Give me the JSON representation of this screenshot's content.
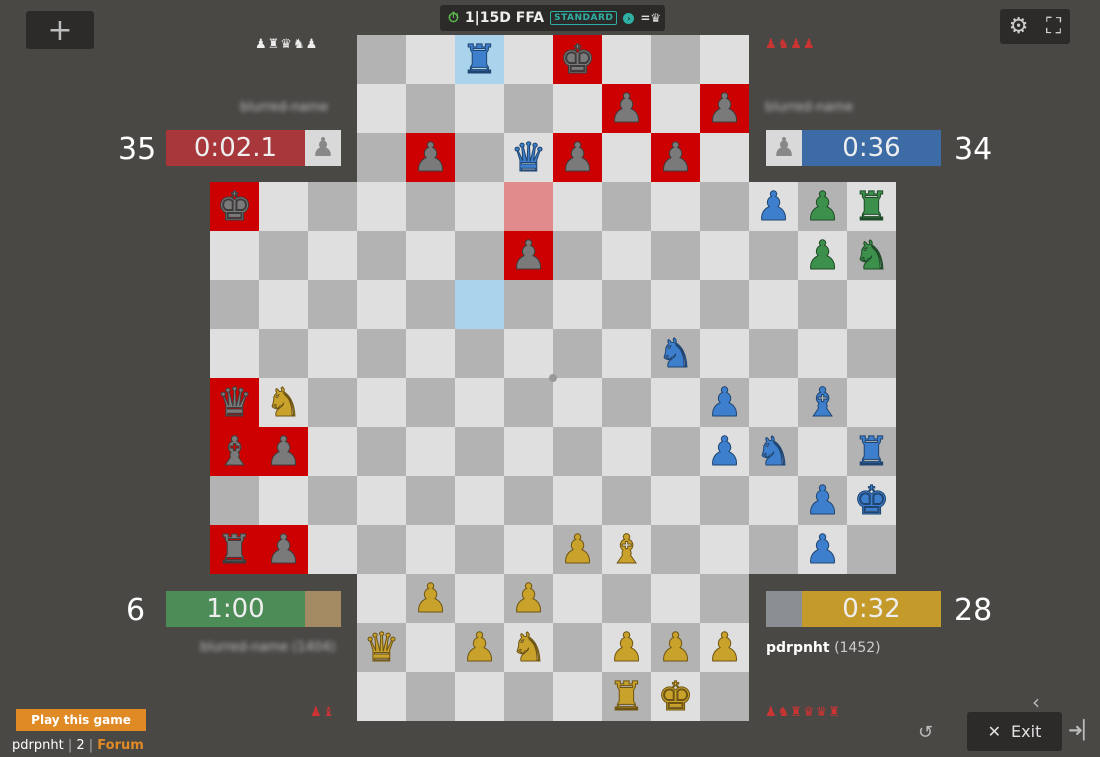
{
  "header": {
    "add_icon": "+",
    "timer_icon": "⏱",
    "time_control": "1|15D FFA",
    "mode_badge": "STANDARD",
    "info_icon": "›",
    "variant_icon": "=♛"
  },
  "toolbar": {
    "settings_icon": "⚙",
    "fullscreen_icon": "⛶"
  },
  "players": {
    "red": {
      "name": "blurred-name",
      "score": "35",
      "clock": "0:02.1",
      "clock_color": "#a8373c",
      "avatar": "♟",
      "captured": "♟♞♟♟"
    },
    "blue": {
      "name": "blurred-name",
      "score": "34",
      "clock": "0:36",
      "clock_color": "#3c6ba6",
      "avatar": "♟",
      "captured": "♟♜♛♞♟"
    },
    "yellow": {
      "name": "blurred-name (1404)",
      "score": "6",
      "clock": "1:00",
      "clock_color": "#4c8c56",
      "avatar": "",
      "captured": "♟♝"
    },
    "green": {
      "name": "pdrpnht",
      "rating": "(1452)",
      "score": "28",
      "clock": "0:32",
      "clock_color": "#c49a2a",
      "avatar": "",
      "captured": "♟♞♜♛♛♜"
    }
  },
  "board": {
    "pieces": [
      {
        "r": 0,
        "c": 5,
        "p": "♜",
        "k": "blue"
      },
      {
        "r": 0,
        "c": 7,
        "p": "♚",
        "k": "red"
      },
      {
        "r": 1,
        "c": 8,
        "p": "♟",
        "k": "red"
      },
      {
        "r": 1,
        "c": 10,
        "p": "♟",
        "k": "red"
      },
      {
        "r": 2,
        "c": 4,
        "p": "♟",
        "k": "red"
      },
      {
        "r": 2,
        "c": 6,
        "p": "♛",
        "k": "blue"
      },
      {
        "r": 2,
        "c": 7,
        "p": "♟",
        "k": "red"
      },
      {
        "r": 2,
        "c": 9,
        "p": "♟",
        "k": "red"
      },
      {
        "r": 3,
        "c": 0,
        "p": "♚",
        "k": "red"
      },
      {
        "r": 3,
        "c": 11,
        "p": "♟",
        "k": "blue"
      },
      {
        "r": 3,
        "c": 12,
        "p": "♟",
        "k": "green"
      },
      {
        "r": 3,
        "c": 13,
        "p": "♜",
        "k": "green"
      },
      {
        "r": 4,
        "c": 6,
        "p": "♟",
        "k": "red"
      },
      {
        "r": 4,
        "c": 12,
        "p": "♟",
        "k": "green"
      },
      {
        "r": 4,
        "c": 13,
        "p": "♞",
        "k": "green"
      },
      {
        "r": 6,
        "c": 9,
        "p": "♞",
        "k": "blue"
      },
      {
        "r": 7,
        "c": 0,
        "p": "♛",
        "k": "red"
      },
      {
        "r": 7,
        "c": 1,
        "p": "♞",
        "k": "yellow"
      },
      {
        "r": 7,
        "c": 10,
        "p": "♟",
        "k": "blue"
      },
      {
        "r": 7,
        "c": 12,
        "p": "♝",
        "k": "blue"
      },
      {
        "r": 8,
        "c": 0,
        "p": "♝",
        "k": "red"
      },
      {
        "r": 8,
        "c": 1,
        "p": "♟",
        "k": "red"
      },
      {
        "r": 8,
        "c": 10,
        "p": "♟",
        "k": "blue"
      },
      {
        "r": 8,
        "c": 11,
        "p": "♞",
        "k": "blue"
      },
      {
        "r": 8,
        "c": 13,
        "p": "♜",
        "k": "blue"
      },
      {
        "r": 9,
        "c": 12,
        "p": "♟",
        "k": "blue"
      },
      {
        "r": 9,
        "c": 13,
        "p": "♚",
        "k": "blue"
      },
      {
        "r": 10,
        "c": 0,
        "p": "♜",
        "k": "red"
      },
      {
        "r": 10,
        "c": 1,
        "p": "♟",
        "k": "red"
      },
      {
        "r": 10,
        "c": 7,
        "p": "♟",
        "k": "yellow"
      },
      {
        "r": 10,
        "c": 8,
        "p": "♝",
        "k": "yellow"
      },
      {
        "r": 10,
        "c": 12,
        "p": "♟",
        "k": "blue"
      },
      {
        "r": 11,
        "c": 4,
        "p": "♟",
        "k": "yellow"
      },
      {
        "r": 11,
        "c": 6,
        "p": "♟",
        "k": "yellow"
      },
      {
        "r": 12,
        "c": 3,
        "p": "♛",
        "k": "yellow"
      },
      {
        "r": 12,
        "c": 5,
        "p": "♟",
        "k": "yellow"
      },
      {
        "r": 12,
        "c": 6,
        "p": "♞",
        "k": "yellow"
      },
      {
        "r": 12,
        "c": 8,
        "p": "♟",
        "k": "yellow"
      },
      {
        "r": 12,
        "c": 9,
        "p": "♟",
        "k": "yellow"
      },
      {
        "r": 12,
        "c": 10,
        "p": "♟",
        "k": "yellow"
      },
      {
        "r": 13,
        "c": 8,
        "p": "♜",
        "k": "yellow"
      },
      {
        "r": 13,
        "c": 9,
        "p": "♚",
        "k": "yellow"
      }
    ],
    "eliminated_squares": [
      [
        0,
        7
      ],
      [
        1,
        8
      ],
      [
        1,
        10
      ],
      [
        2,
        4
      ],
      [
        2,
        7
      ],
      [
        2,
        9
      ],
      [
        3,
        0
      ],
      [
        4,
        6
      ],
      [
        7,
        0
      ],
      [
        8,
        0
      ],
      [
        8,
        1
      ],
      [
        10,
        0
      ],
      [
        10,
        1
      ]
    ],
    "highlight_squares": [
      [
        0,
        5
      ],
      [
        5,
        5
      ]
    ],
    "highlight_red_squares": [
      [
        3,
        6
      ]
    ]
  },
  "footer": {
    "play_button": "Play this game",
    "user": "pdrpnht",
    "separator1": " | ",
    "count": "2",
    "separator2": " | ",
    "forum": "Forum",
    "undo_icon": "↺",
    "collapse_icon": "‹",
    "exit_icon": "✕",
    "exit_label": "Exit",
    "leave_icon": "➜▏"
  }
}
